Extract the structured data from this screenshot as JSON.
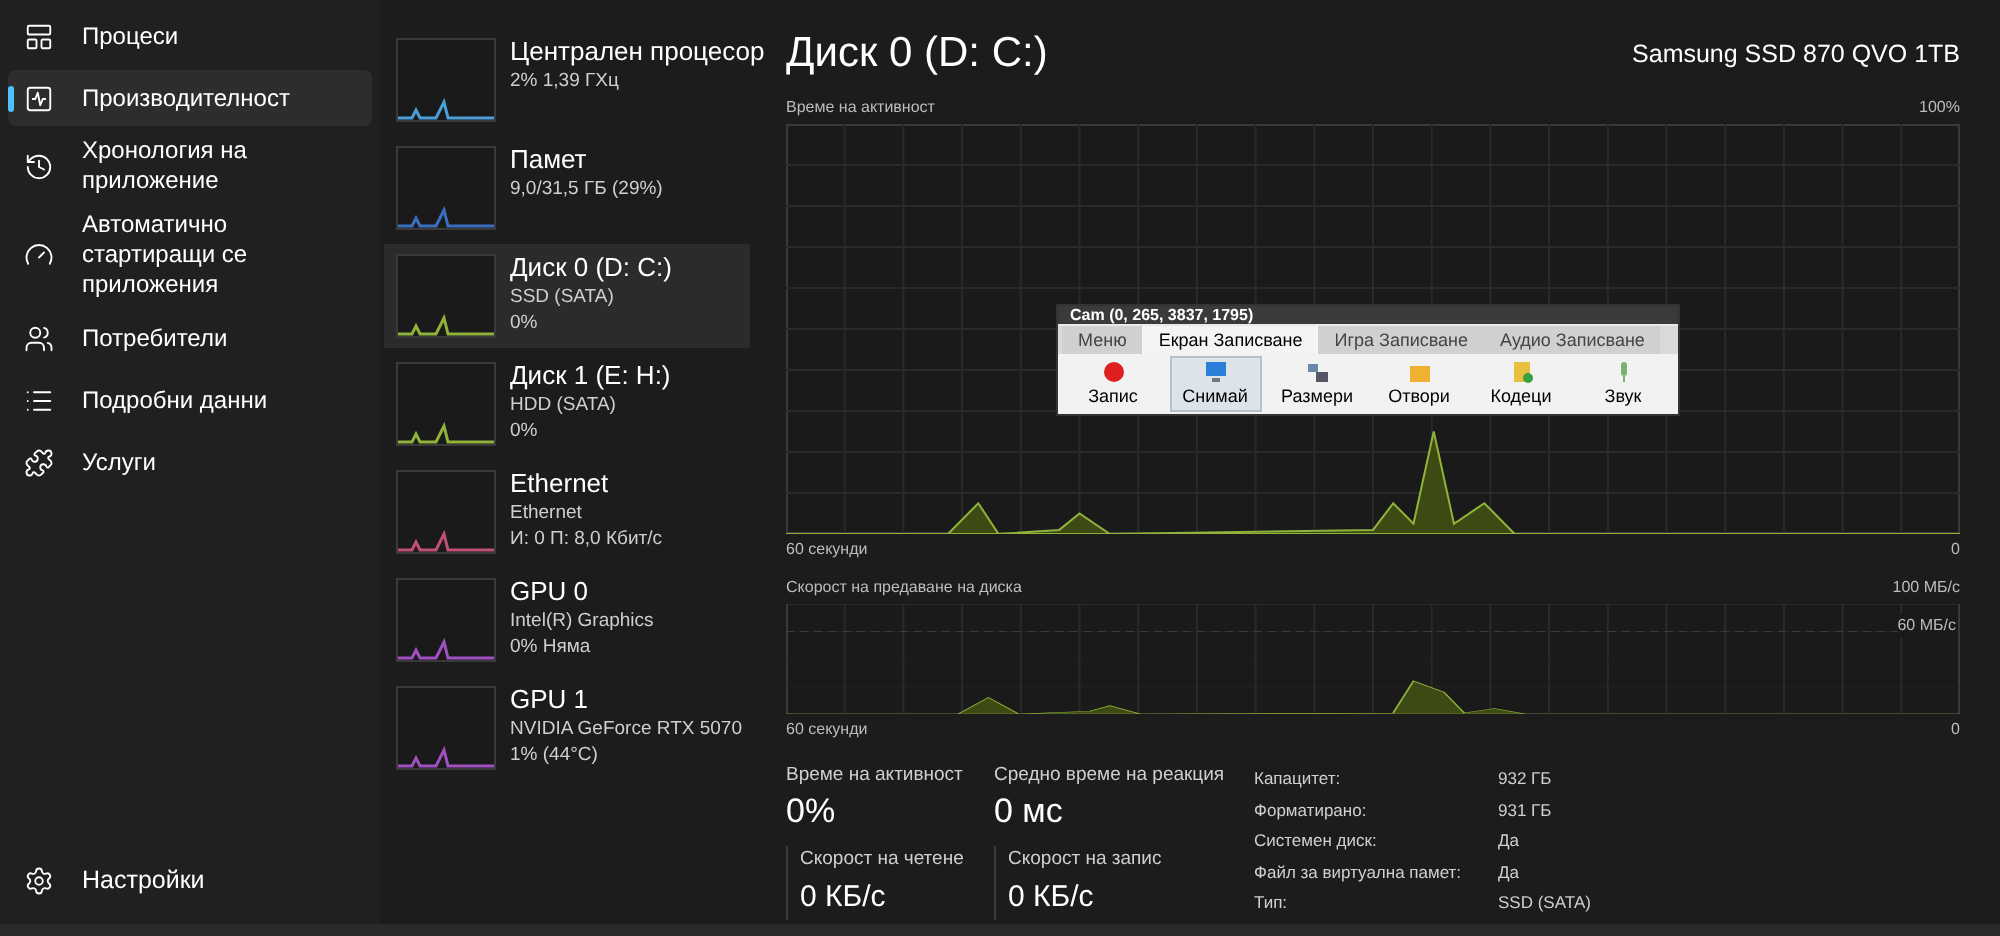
{
  "nav": {
    "items": [
      {
        "label": "Процеси",
        "selected": false
      },
      {
        "label": "Производителност",
        "selected": true
      },
      {
        "label": "Хронология на приложение",
        "selected": false
      },
      {
        "label": "Автоматично стартиращи се приложения",
        "selected": false
      },
      {
        "label": "Потребители",
        "selected": false
      },
      {
        "label": "Подробни данни",
        "selected": false
      },
      {
        "label": "Услуги",
        "selected": false
      }
    ],
    "settings": "Настройки"
  },
  "devices": [
    {
      "name": "Централен процесор",
      "lines": [
        "2%  1,39 ГХц"
      ],
      "color": "#4a9fd8",
      "selected": false
    },
    {
      "name": "Памет",
      "lines": [
        "9,0/31,5 ГБ (29%)"
      ],
      "color": "#3a6fc0",
      "selected": false
    },
    {
      "name": "Диск 0 (D: C:)",
      "lines": [
        "SSD (SATA)",
        "0%"
      ],
      "color": "#8fb33a",
      "selected": true
    },
    {
      "name": "Диск 1 (E: H:)",
      "lines": [
        "HDD (SATA)",
        "0%"
      ],
      "color": "#8fb33a",
      "selected": false
    },
    {
      "name": "Ethernet",
      "lines": [
        "Ethernet",
        "И: 0  П: 8,0 Кбит/с"
      ],
      "color": "#c0507a",
      "selected": false
    },
    {
      "name": "GPU 0",
      "lines": [
        "Intel(R) Graphics",
        "0%  Няма"
      ],
      "color": "#a050c0",
      "selected": false
    },
    {
      "name": "GPU 1",
      "lines": [
        "NVIDIA GeForce RTX 5070",
        "1%  (44°C)"
      ],
      "color": "#a050c0",
      "selected": false
    }
  ],
  "detail": {
    "title": "Диск 0 (D: C:)",
    "model": "Samsung SSD 870 QVO 1TB",
    "activity_chart": {
      "label": "Време на активност",
      "max": "100%",
      "time": "60 секунди",
      "min": "0"
    },
    "transfer_chart": {
      "label": "Скорост на предаване на диска",
      "max": "100 МБ/с",
      "mid": "60 МБ/с",
      "time": "60 секунди",
      "min": "0"
    },
    "stats": [
      {
        "label": "Време на активност",
        "value": "0%"
      },
      {
        "label": "Средно време на реакция",
        "value": "0 мс"
      }
    ],
    "speeds": [
      {
        "label": "Скорост на четене",
        "value": "0 КБ/с"
      },
      {
        "label": "Скорост на запис",
        "value": "0 КБ/с"
      }
    ],
    "properties": [
      {
        "key": "Капацитет:",
        "value": "932 ГБ"
      },
      {
        "key": "Форматирано:",
        "value": "931 ГБ"
      },
      {
        "key": "Системен диск:",
        "value": "Да"
      },
      {
        "key": "Файл за виртуална памет:",
        "value": "Да"
      },
      {
        "key": "Тип:",
        "value": "SSD (SATA)"
      }
    ]
  },
  "recorder": {
    "title": "Cam (0, 265, 3837, 1795)",
    "tabs": [
      {
        "label": "Меню",
        "selected": false
      },
      {
        "label": "Екран Записване",
        "selected": true
      },
      {
        "label": "Игра Записване",
        "selected": false
      },
      {
        "label": "Аудио Записване",
        "selected": false
      }
    ],
    "tools": [
      {
        "label": "Запис",
        "selected": false
      },
      {
        "label": "Снимай",
        "selected": true
      },
      {
        "label": "Размери",
        "selected": false
      },
      {
        "label": "Отвори",
        "selected": false
      },
      {
        "label": "Кодеци",
        "selected": false
      },
      {
        "label": "Звук",
        "selected": false
      }
    ]
  }
}
